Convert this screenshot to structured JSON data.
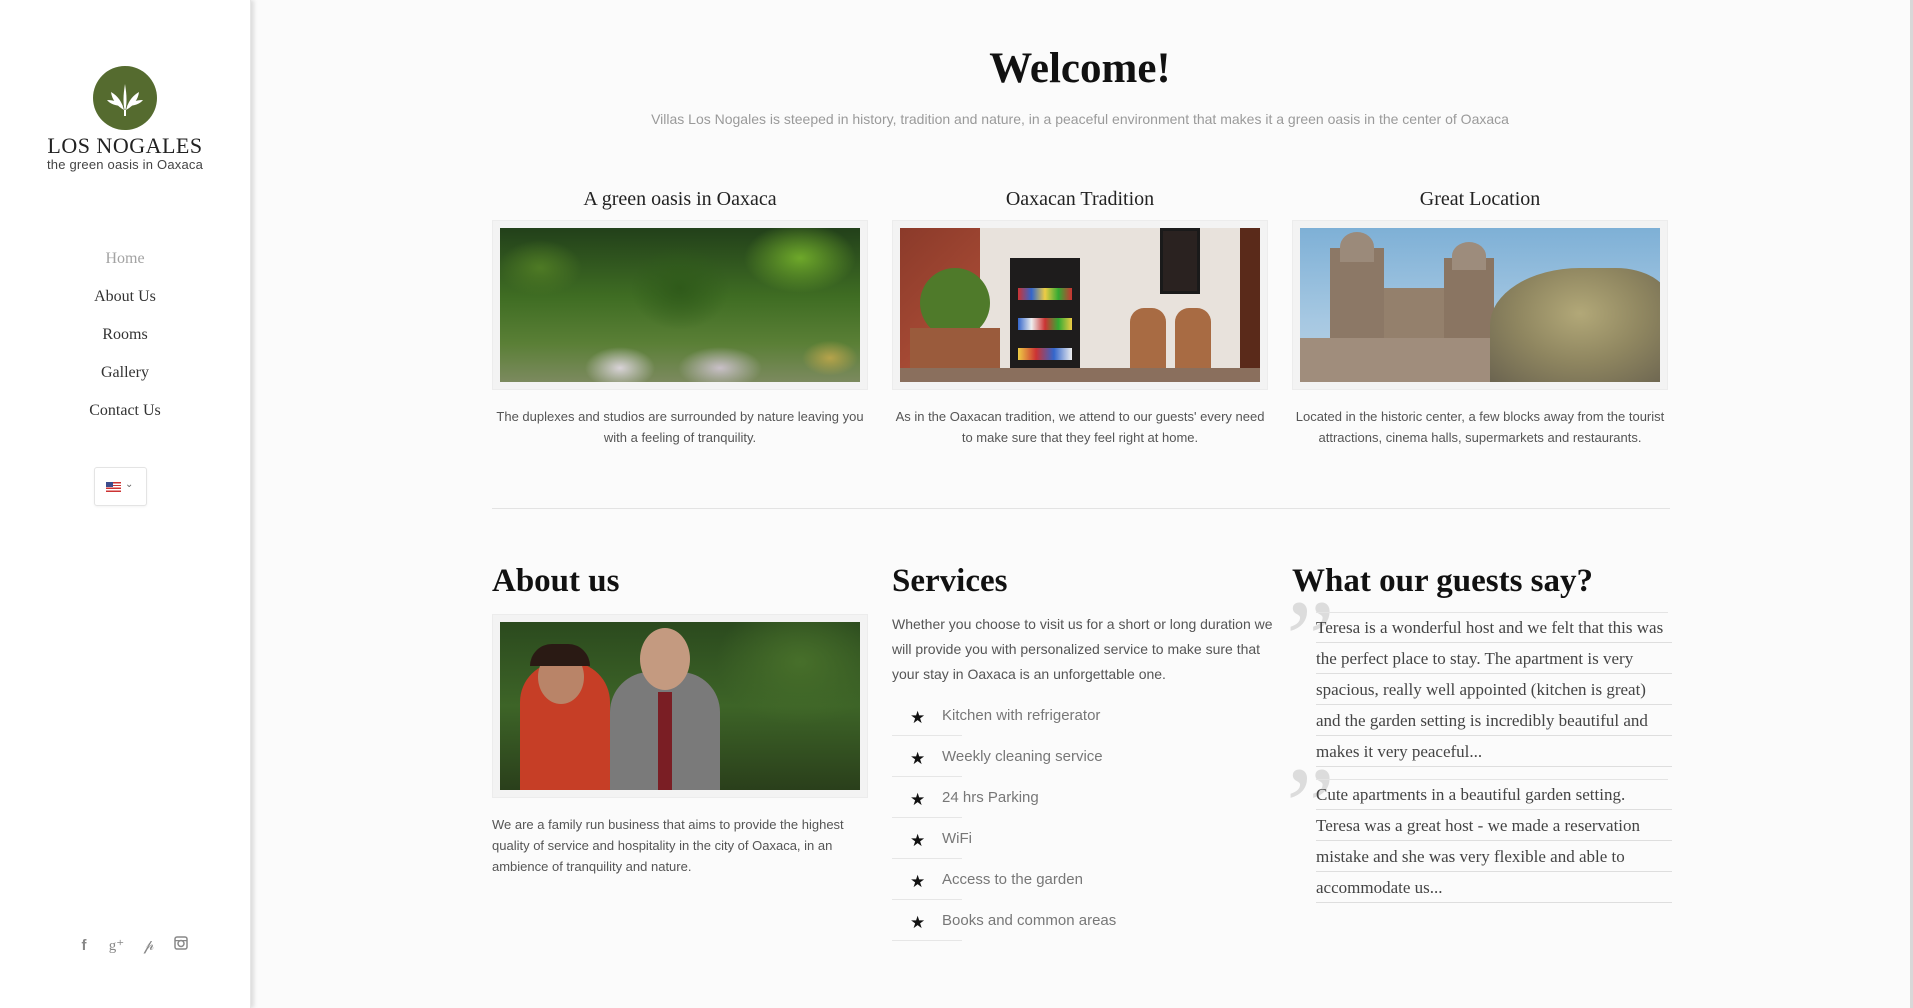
{
  "sidebar": {
    "logo": {
      "name": "LOS NOGALES",
      "tagline": "the green oasis in Oaxaca"
    },
    "nav": [
      {
        "label": "Home",
        "active": true
      },
      {
        "label": "About Us"
      },
      {
        "label": "Rooms"
      },
      {
        "label": "Gallery"
      },
      {
        "label": "Contact Us"
      }
    ],
    "language": {
      "selected": "English (US flag)",
      "caret": "⌄"
    },
    "social": [
      "facebook",
      "google-plus",
      "pinterest",
      "instagram"
    ],
    "brand_color": "#556b2f"
  },
  "main": {
    "welcome_title": "Welcome!",
    "intro": "Villas Los Nogales is steeped in history, tradition and nature, in a peaceful environment that makes it a green oasis in the center of Oaxaca",
    "features": [
      {
        "title": "A green oasis in Oaxaca",
        "text": "The duplexes and studios are surrounded by nature leaving you with a feeling of tranquility."
      },
      {
        "title": "Oaxacan Tradition",
        "text": "As in the Oaxacan tradition, we attend to our guests' every need to make sure that they feel right at home."
      },
      {
        "title": "Great Location",
        "text": "Located in the historic center, a few blocks away from the tourist attractions, cinema halls, supermarkets and restaurants."
      }
    ],
    "about": {
      "title": "About us",
      "text": "We are a family run business that aims to provide the highest quality of service and hospitality in the city of Oaxaca, in an ambience of tranquility and nature."
    },
    "services": {
      "title": "Services",
      "text": "Whether you choose to visit us for a short or long duration we will provide you with personalized service to make sure that your stay in Oaxaca is an unforgettable one.",
      "items": [
        "Kitchen with refrigerator",
        "Weekly cleaning service",
        "24 hrs Parking",
        "WiFi",
        "Access to the garden",
        "Books and common areas"
      ]
    },
    "testimonials": {
      "title": "What our guests say?",
      "quotes": [
        "Teresa is a wonderful host and we felt that this was the perfect place to stay. The apartment is very spacious, really well appointed (kitchen is great) and the garden setting is incredibly beautiful and makes it very peaceful...",
        "Cute apartments in a beautiful garden setting. Teresa was a great host - we made a reservation mistake and she was very flexible and able to accommodate us..."
      ]
    }
  }
}
